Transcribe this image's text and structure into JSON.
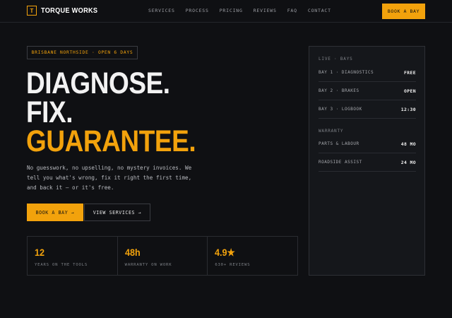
{
  "brand": {
    "mark": "T",
    "name": "TORQUE WORKS"
  },
  "nav": [
    "SERVICES",
    "PROCESS",
    "PRICING",
    "REVIEWS",
    "FAQ",
    "CONTACT"
  ],
  "header_cta": "BOOK A BAY",
  "badge": "BRISBANE NORTHSIDE · OPEN 6 DAYS",
  "headline": {
    "line1": "DIAGNOSE.",
    "line2": "FIX.",
    "line3": "GUARANTEE."
  },
  "description": "No guesswork, no upselling, no mystery invoices. We tell you what's wrong, fix it right the first time, and back it — or it's free.",
  "buttons": {
    "primary": "BOOK A BAY →",
    "secondary": "VIEW SERVICES →"
  },
  "stats": [
    {
      "value": "12",
      "label": "YEARS ON THE TOOLS"
    },
    {
      "value": "48h",
      "label": "WARRANTY ON WORK"
    },
    {
      "value": "4.9★",
      "label": "630+ REVIEWS"
    }
  ],
  "panel": {
    "live_title": "LIVE · BAYS",
    "bays": [
      {
        "label": "BAY 1 · DIAGNOSTICS",
        "value": "FREE"
      },
      {
        "label": "BAY 2 · BRAKES",
        "value": "OPEN"
      },
      {
        "label": "BAY 3 · LOGBOOK",
        "value": "12:30"
      }
    ],
    "warranty_title": "WARRANTY",
    "warranty": [
      {
        "label": "PARTS & LABOUR",
        "value": "48 MO"
      },
      {
        "label": "ROADSIDE ASSIST",
        "value": "24 MO"
      }
    ]
  },
  "colors": {
    "accent": "#f2a20c",
    "background": "#0f1013",
    "panel": "#15171b"
  }
}
